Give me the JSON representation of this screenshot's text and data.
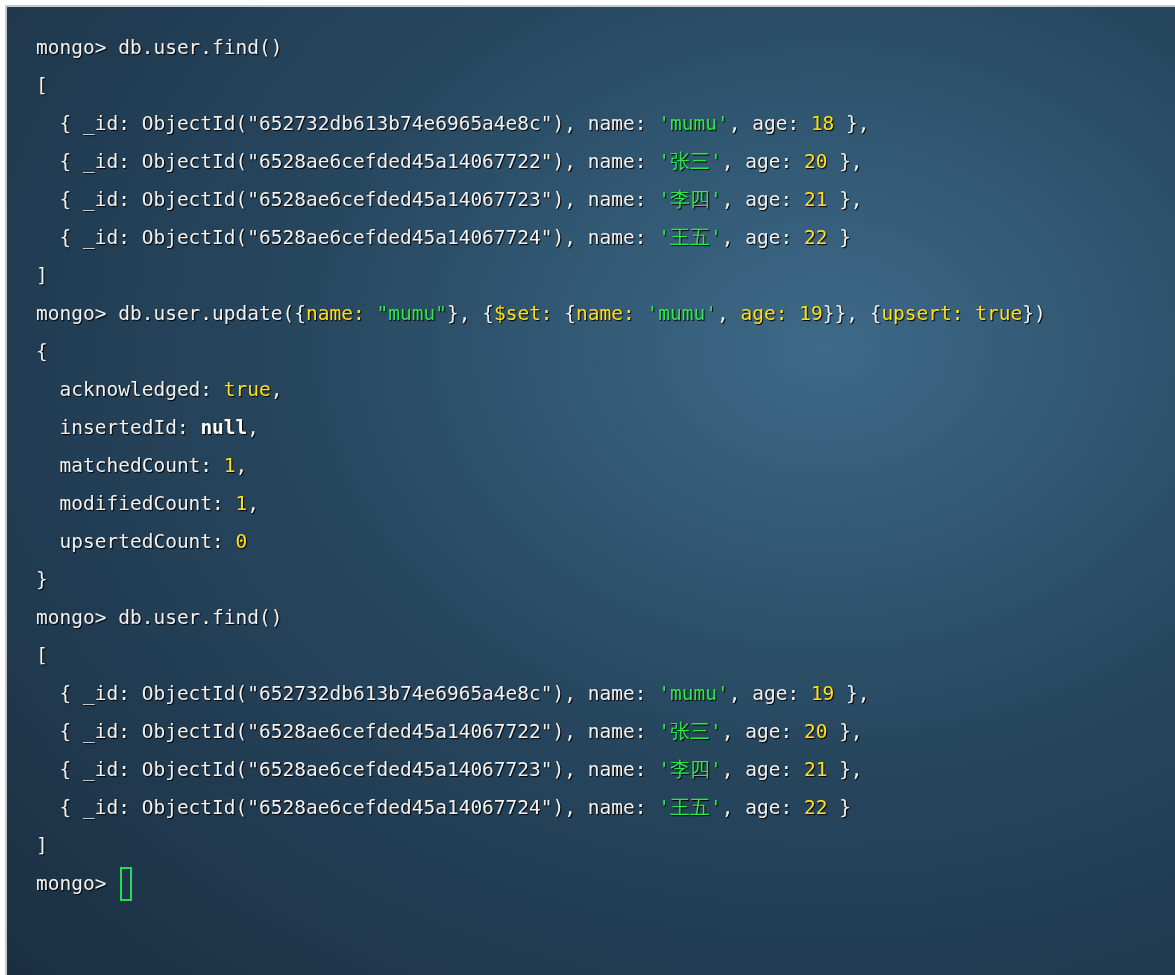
{
  "terminal": {
    "lines": [
      {
        "tokens": [
          {
            "kind": "plain",
            "text": "mongo> db.user.find()"
          }
        ]
      },
      {
        "tokens": [
          {
            "kind": "plain",
            "text": "["
          }
        ]
      },
      {
        "tokens": [
          {
            "kind": "plain",
            "text": "  { _id: ObjectId(\"652732db613b74e6965a4e8c\"), name: "
          },
          {
            "kind": "string",
            "text": "'mumu'"
          },
          {
            "kind": "plain",
            "text": ", age: "
          },
          {
            "kind": "number",
            "text": "18"
          },
          {
            "kind": "plain",
            "text": " },"
          }
        ]
      },
      {
        "tokens": [
          {
            "kind": "plain",
            "text": "  { _id: ObjectId(\"6528ae6cefded45a14067722\"), name: "
          },
          {
            "kind": "string",
            "text": "'张三'"
          },
          {
            "kind": "plain",
            "text": ", age: "
          },
          {
            "kind": "number",
            "text": "20"
          },
          {
            "kind": "plain",
            "text": " },"
          }
        ]
      },
      {
        "tokens": [
          {
            "kind": "plain",
            "text": "  { _id: ObjectId(\"6528ae6cefded45a14067723\"), name: "
          },
          {
            "kind": "string",
            "text": "'李四'"
          },
          {
            "kind": "plain",
            "text": ", age: "
          },
          {
            "kind": "number",
            "text": "21"
          },
          {
            "kind": "plain",
            "text": " },"
          }
        ]
      },
      {
        "tokens": [
          {
            "kind": "plain",
            "text": "  { _id: ObjectId(\"6528ae6cefded45a14067724\"), name: "
          },
          {
            "kind": "string",
            "text": "'王五'"
          },
          {
            "kind": "plain",
            "text": ", age: "
          },
          {
            "kind": "number",
            "text": "22"
          },
          {
            "kind": "plain",
            "text": " }"
          }
        ]
      },
      {
        "tokens": [
          {
            "kind": "plain",
            "text": "]"
          }
        ]
      },
      {
        "tokens": [
          {
            "kind": "plain",
            "text": "mongo> db.user.update({"
          },
          {
            "kind": "keyword",
            "text": "name: "
          },
          {
            "kind": "string",
            "text": "\"mumu\""
          },
          {
            "kind": "plain",
            "text": "}, {"
          },
          {
            "kind": "keyword",
            "text": "$set:"
          },
          {
            "kind": "plain",
            "text": " {"
          },
          {
            "kind": "keyword",
            "text": "name: "
          },
          {
            "kind": "string",
            "text": "'mumu'"
          },
          {
            "kind": "plain",
            "text": ", "
          },
          {
            "kind": "keyword",
            "text": "age: "
          },
          {
            "kind": "number",
            "text": "19"
          },
          {
            "kind": "plain",
            "text": "}}, {"
          },
          {
            "kind": "keyword",
            "text": "upsert: true"
          },
          {
            "kind": "plain",
            "text": "})"
          }
        ]
      },
      {
        "tokens": [
          {
            "kind": "plain",
            "text": "{"
          }
        ]
      },
      {
        "tokens": [
          {
            "kind": "plain",
            "text": "  acknowledged: "
          },
          {
            "kind": "number",
            "text": "true"
          },
          {
            "kind": "plain",
            "text": ","
          }
        ]
      },
      {
        "tokens": [
          {
            "kind": "plain",
            "text": "  insertedId: "
          },
          {
            "kind": "null",
            "text": "null"
          },
          {
            "kind": "plain",
            "text": ","
          }
        ]
      },
      {
        "tokens": [
          {
            "kind": "plain",
            "text": "  matchedCount: "
          },
          {
            "kind": "number",
            "text": "1"
          },
          {
            "kind": "plain",
            "text": ","
          }
        ]
      },
      {
        "tokens": [
          {
            "kind": "plain",
            "text": "  modifiedCount: "
          },
          {
            "kind": "number",
            "text": "1"
          },
          {
            "kind": "plain",
            "text": ","
          }
        ]
      },
      {
        "tokens": [
          {
            "kind": "plain",
            "text": "  upsertedCount: "
          },
          {
            "kind": "number",
            "text": "0"
          }
        ]
      },
      {
        "tokens": [
          {
            "kind": "plain",
            "text": "}"
          }
        ]
      },
      {
        "tokens": [
          {
            "kind": "plain",
            "text": "mongo> db.user.find()"
          }
        ]
      },
      {
        "tokens": [
          {
            "kind": "plain",
            "text": "["
          }
        ]
      },
      {
        "tokens": [
          {
            "kind": "plain",
            "text": "  { _id: ObjectId(\"652732db613b74e6965a4e8c\"), name: "
          },
          {
            "kind": "string",
            "text": "'mumu'"
          },
          {
            "kind": "plain",
            "text": ", age: "
          },
          {
            "kind": "number",
            "text": "19"
          },
          {
            "kind": "plain",
            "text": " },"
          }
        ]
      },
      {
        "tokens": [
          {
            "kind": "plain",
            "text": "  { _id: ObjectId(\"6528ae6cefded45a14067722\"), name: "
          },
          {
            "kind": "string",
            "text": "'张三'"
          },
          {
            "kind": "plain",
            "text": ", age: "
          },
          {
            "kind": "number",
            "text": "20"
          },
          {
            "kind": "plain",
            "text": " },"
          }
        ]
      },
      {
        "tokens": [
          {
            "kind": "plain",
            "text": "  { _id: ObjectId(\"6528ae6cefded45a14067723\"), name: "
          },
          {
            "kind": "string",
            "text": "'李四'"
          },
          {
            "kind": "plain",
            "text": ", age: "
          },
          {
            "kind": "number",
            "text": "21"
          },
          {
            "kind": "plain",
            "text": " },"
          }
        ]
      },
      {
        "tokens": [
          {
            "kind": "plain",
            "text": "  { _id: ObjectId(\"6528ae6cefded45a14067724\"), name: "
          },
          {
            "kind": "string",
            "text": "'王五'"
          },
          {
            "kind": "plain",
            "text": ", age: "
          },
          {
            "kind": "number",
            "text": "22"
          },
          {
            "kind": "plain",
            "text": " }"
          }
        ]
      },
      {
        "tokens": [
          {
            "kind": "plain",
            "text": "]"
          }
        ]
      },
      {
        "tokens": [
          {
            "kind": "plain",
            "text": "mongo> "
          }
        ],
        "cursor": true
      }
    ]
  }
}
